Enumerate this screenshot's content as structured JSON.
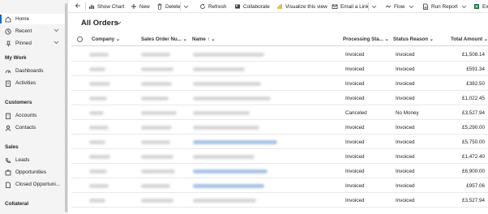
{
  "sidebar": {
    "items": [
      {
        "label": "Home"
      },
      {
        "label": "Recent"
      },
      {
        "label": "Pinned"
      }
    ],
    "groups": [
      {
        "title": "My Work",
        "items": [
          {
            "label": "Dashboards"
          },
          {
            "label": "Activities"
          }
        ]
      },
      {
        "title": "Customers",
        "items": [
          {
            "label": "Accounts"
          },
          {
            "label": "Contacts"
          }
        ]
      },
      {
        "title": "Sales",
        "items": [
          {
            "label": "Leads"
          },
          {
            "label": "Opportunities"
          },
          {
            "label": "Closed Opportuni..."
          }
        ]
      },
      {
        "title": "Collateral",
        "items": []
      }
    ]
  },
  "toolbar": {
    "show_chart": "Show Chart",
    "new": "New",
    "delete": "Delete",
    "refresh": "Refresh",
    "collaborate": "Collaborate",
    "visualize": "Visualize this view",
    "email_link": "Email a Link",
    "flow": "Flow",
    "run_report": "Run Report",
    "export": "Ex"
  },
  "view": {
    "title": "All Orders"
  },
  "grid": {
    "columns": {
      "company": "Company",
      "order_number": "Sales Order Nu...",
      "name": "Name",
      "processing_status": "Processing Sta...",
      "status_reason": "Status Reason",
      "total_amount": "Total Amount"
    },
    "rows": [
      {
        "processing": "Invoiced",
        "reason": "Invoiced",
        "amount": "£1,508.14"
      },
      {
        "processing": "Invoiced",
        "reason": "Invoiced",
        "amount": "£591.34"
      },
      {
        "processing": "Invoiced",
        "reason": "Invoiced",
        "amount": "£382.50"
      },
      {
        "processing": "Invoiced",
        "reason": "Invoiced",
        "amount": "£1,022.45"
      },
      {
        "processing": "Canceled",
        "reason": "No Money",
        "amount": "£3,527.94"
      },
      {
        "processing": "Invoiced",
        "reason": "Invoiced",
        "amount": "£5,290.00"
      },
      {
        "processing": "Invoiced",
        "reason": "Invoiced",
        "amount": "£5,750.00"
      },
      {
        "processing": "Invoiced",
        "reason": "Invoiced",
        "amount": "£1,472.40"
      },
      {
        "processing": "Invoiced",
        "reason": "Invoiced",
        "amount": "£6,900.00"
      },
      {
        "processing": "Invoiced",
        "reason": "Invoiced",
        "amount": "£957.06"
      },
      {
        "processing": "Invoiced",
        "reason": "Invoiced",
        "amount": "£3,527.94"
      }
    ]
  }
}
